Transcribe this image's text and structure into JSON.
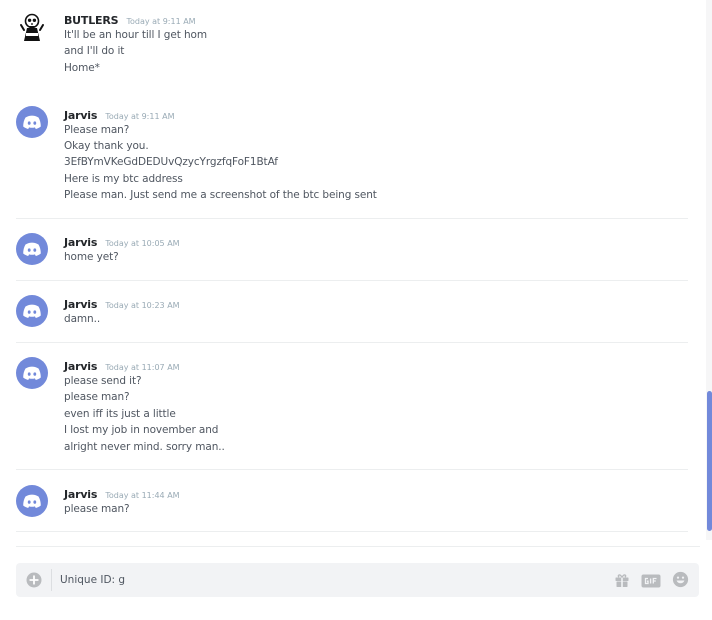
{
  "messages": [
    {
      "author": "BUTLERS",
      "timestamp": "Today at 9:11 AM",
      "avatar": "skeleton-avatar",
      "lines": [
        "It'll be an hour till I get hom",
        "and I'll do it",
        "Home*"
      ]
    },
    {
      "author": "Jarvis",
      "timestamp": "Today at 9:11 AM",
      "avatar": "discord-default-avatar",
      "lines": [
        "Please man?",
        "Okay thank you.",
        "3EfBYmVKeGdDEDUvQzycYrgzfqFoF1BtAf",
        "Here is my btc address",
        "Please man.  Just send me a screenshot of the btc being sent"
      ]
    },
    {
      "author": "Jarvis",
      "timestamp": "Today at 10:05 AM",
      "avatar": "discord-default-avatar",
      "lines": [
        "home yet?"
      ]
    },
    {
      "author": "Jarvis",
      "timestamp": "Today at 10:23 AM",
      "avatar": "discord-default-avatar",
      "lines": [
        "damn.."
      ]
    },
    {
      "author": "Jarvis",
      "timestamp": "Today at 11:07 AM",
      "avatar": "discord-default-avatar",
      "lines": [
        "please send it?",
        "please man?",
        "even iff its just a little",
        "I lost my job in november and",
        "alright never mind.  sorry man.."
      ]
    },
    {
      "author": "Jarvis",
      "timestamp": "Today at 11:44 AM",
      "avatar": "discord-default-avatar",
      "lines": [
        "please man?"
      ]
    }
  ],
  "composer": {
    "value": "Unique ID: g",
    "upload_icon": "plus-circle-icon",
    "tools": [
      "gift-icon",
      "gif-icon",
      "emoji-icon"
    ]
  },
  "colors": {
    "accent": "#7289da",
    "username": "#23262a",
    "text": "#4f5660",
    "timestamp": "#99aab5",
    "input_bg": "#f2f3f5"
  }
}
